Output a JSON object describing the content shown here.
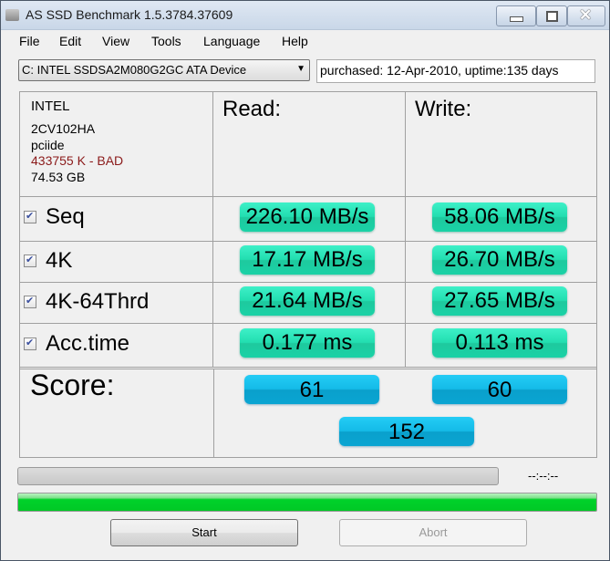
{
  "window": {
    "title": "AS SSD Benchmark 1.5.3784.37609",
    "icon": "ssd-drive-icon",
    "controls": [
      "minimize-icon",
      "maximize-icon",
      "close-icon"
    ]
  },
  "menu": {
    "items": [
      "File",
      "Edit",
      "View",
      "Tools",
      "Language",
      "Help"
    ]
  },
  "drive": {
    "selected": "C: INTEL SSDSA2M080G2GC ATA Device",
    "info": "purchased: 12-Apr-2010, uptime:135 days"
  },
  "device_info": {
    "vendor": "INTEL",
    "firmware": "2CV102HA",
    "driver": "pciide",
    "alignment": "433755 K - BAD",
    "alignment_color": "#8b1a1a",
    "capacity": "74.53 GB"
  },
  "columns": {
    "read": "Read:",
    "write": "Write:"
  },
  "tests": [
    {
      "label": "Seq",
      "checked": true,
      "read": "226.10 MB/s",
      "write": "58.06 MB/s"
    },
    {
      "label": "4K",
      "checked": true,
      "read": "17.17 MB/s",
      "write": "26.70 MB/s"
    },
    {
      "label": "4K-64Thrd",
      "checked": true,
      "read": "21.64 MB/s",
      "write": "27.65 MB/s"
    },
    {
      "label": "Acc.time",
      "checked": true,
      "read": "0.177 ms",
      "write": "0.113 ms"
    }
  ],
  "score": {
    "label": "Score:",
    "read": "61",
    "write": "60",
    "total": "152"
  },
  "progress": {
    "test_progress_percent": 0,
    "timer": "--:--:--",
    "overall_progress_percent": 100
  },
  "buttons": {
    "start": "Start",
    "abort": "Abort",
    "abort_enabled": false
  },
  "colors": {
    "value_pill": "#22deb0",
    "score_pill": "#14bbe8",
    "progress_fill": "#00d22a"
  }
}
